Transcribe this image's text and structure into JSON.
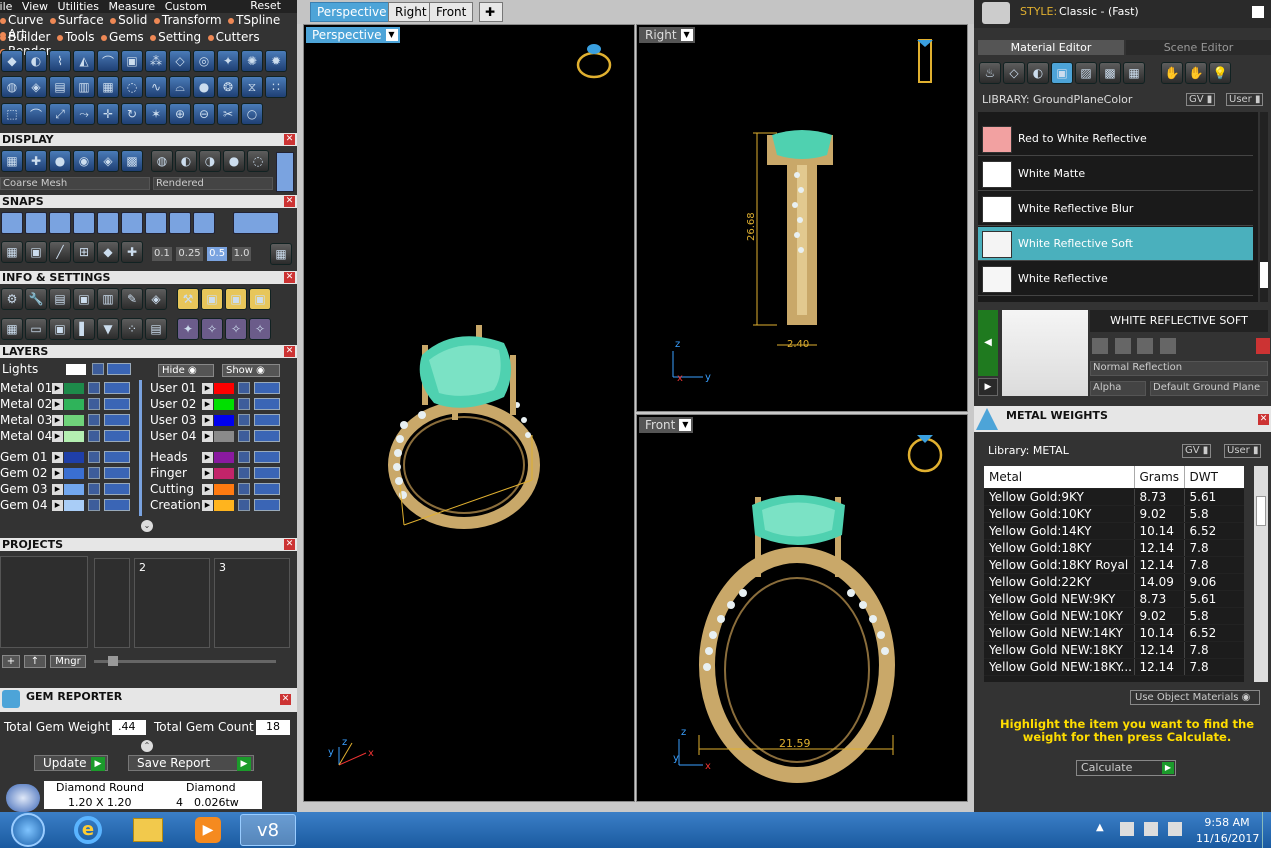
{
  "menu": [
    "File",
    "View",
    "Utilities",
    "Measure",
    "Custom"
  ],
  "menu_reset": "Reset",
  "modules_row1": [
    "Curve",
    "Surface",
    "Solid",
    "Transform",
    "TSpline",
    "Art"
  ],
  "modules_row2": [
    "Builder",
    "Tools",
    "Gems",
    "Setting",
    "Cutters",
    "Render"
  ],
  "display": {
    "title": "DISPLAY",
    "mesh_dropdown": "Coarse Mesh",
    "render_dropdown": "Rendered"
  },
  "snaps": {
    "title": "SNAPS",
    "values": [
      "0.1",
      "0.25",
      "0.5",
      "1.0"
    ],
    "selected": "0.5"
  },
  "info_settings": {
    "title": "INFO & SETTINGS"
  },
  "layers": {
    "title": "LAYERS",
    "lights": "Lights",
    "hide": "Hide",
    "show": "Show",
    "left": [
      {
        "name": "Metal 01",
        "color": "#1d8a4a"
      },
      {
        "name": "Metal 02",
        "color": "#2fb35a"
      },
      {
        "name": "Metal 03",
        "color": "#6fd27a"
      },
      {
        "name": "Metal 04",
        "color": "#b4efb1"
      },
      {
        "name": "Gem 01",
        "color": "#1f3fa8"
      },
      {
        "name": "Gem 02",
        "color": "#3a6fd1"
      },
      {
        "name": "Gem 03",
        "color": "#72a7ee"
      },
      {
        "name": "Gem 04",
        "color": "#a9cdf7"
      }
    ],
    "right": [
      {
        "name": "User 01",
        "color": "#ff0000"
      },
      {
        "name": "User 02",
        "color": "#00e000"
      },
      {
        "name": "User 03",
        "color": "#0000ee"
      },
      {
        "name": "User 04",
        "color": "#8a8a8a"
      },
      {
        "name": "Heads",
        "color": "#8a1aa0"
      },
      {
        "name": "Finger",
        "color": "#c3246a"
      },
      {
        "name": "Cutting",
        "color": "#ff7a10"
      },
      {
        "name": "Creation",
        "color": "#ffb41e"
      }
    ]
  },
  "projects": {
    "title": "PROJECTS",
    "slots": [
      "2",
      "3"
    ],
    "mngr": "Mngr"
  },
  "gem_reporter": {
    "title": "GEM REPORTER",
    "total_weight_label": "Total Gem Weight",
    "total_weight": ".44",
    "total_count_label": "Total Gem Count",
    "total_count": "18",
    "update": "Update",
    "save_report": "Save Report",
    "row": {
      "shape": "Diamond Round",
      "type": "Diamond",
      "size": "1.20 X 1.20",
      "count": "4",
      "weight": "0.026tw"
    }
  },
  "viewports": {
    "tabs": [
      "Perspective",
      "Right",
      "Front"
    ],
    "active_tab": "Perspective",
    "perspective_label": "Perspective",
    "right_label": "Right",
    "front_label": "Front",
    "right_dim_height": "26.68",
    "right_dim_width": "2.40",
    "front_dim_width": "21.59",
    "axis_x": "x",
    "axis_y": "y",
    "axis_z": "z"
  },
  "right_panel": {
    "style_label": "STYLE:",
    "style_value": "Classic - (Fast)",
    "tab_material_editor": "Material Editor",
    "tab_scene_editor": "Scene Editor",
    "library_label": "LIBRARY: GroundPlaneColor",
    "gv": "GV",
    "user": "User",
    "materials": [
      {
        "name": "Red to White Reflective",
        "color": "#f2a1a1"
      },
      {
        "name": "White Matte",
        "color": "#ffffff"
      },
      {
        "name": "White Reflective Blur",
        "color": "#ffffff"
      },
      {
        "name": "White Reflective Soft",
        "color": "#f4f4f4"
      },
      {
        "name": "White Reflective",
        "color": "#f6f6f6"
      }
    ],
    "selected_material": "White Reflective Soft",
    "preview_title": "WHITE REFLECTIVE SOFT",
    "reflection_dropdown": "Normal Reflection",
    "alpha_dropdown": "Alpha",
    "ground_dropdown": "Default Ground Plane",
    "metal_weights_title": "METAL WEIGHTS",
    "metal_library": "Library: METAL",
    "table_headers": [
      "Metal",
      "Grams",
      "DWT"
    ],
    "table_rows": [
      [
        "Yellow Gold:9KY",
        "8.73",
        "5.61"
      ],
      [
        "Yellow Gold:10KY",
        "9.02",
        "5.8"
      ],
      [
        "Yellow Gold:14KY",
        "10.14",
        "6.52"
      ],
      [
        "Yellow Gold:18KY",
        "12.14",
        "7.8"
      ],
      [
        "Yellow Gold:18KY Royal",
        "12.14",
        "7.8"
      ],
      [
        "Yellow Gold:22KY",
        "14.09",
        "9.06"
      ],
      [
        "Yellow Gold NEW:9KY",
        "8.73",
        "5.61"
      ],
      [
        "Yellow Gold NEW:10KY",
        "9.02",
        "5.8"
      ],
      [
        "Yellow Gold NEW:14KY",
        "10.14",
        "6.52"
      ],
      [
        "Yellow Gold NEW:18KY",
        "12.14",
        "7.8"
      ],
      [
        "Yellow Gold NEW:18KY...",
        "12.14",
        "7.8"
      ]
    ],
    "use_object_materials": "Use Object Materials",
    "hint": "Highlight the item you want to find the weight for then press Calculate.",
    "calculate": "Calculate"
  },
  "taskbar": {
    "time": "9:58 AM",
    "date": "11/16/2017",
    "app_label": "v8"
  }
}
